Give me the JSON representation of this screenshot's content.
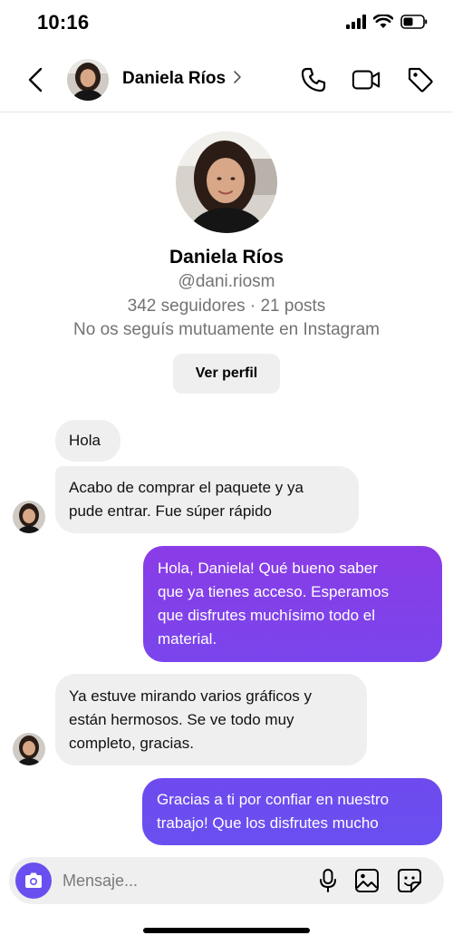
{
  "status_bar": {
    "time": "10:16",
    "icons": [
      "signal-icon",
      "wifi-icon",
      "battery-icon"
    ]
  },
  "header": {
    "contact_name": "Daniela Ríos",
    "icons": [
      "back-arrow-icon",
      "chevron-right-icon",
      "phone-icon",
      "video-camera-icon",
      "tag-icon"
    ]
  },
  "profile": {
    "name": "Daniela Ríos",
    "handle": "@dani.riosm",
    "stats": "342 seguidores · 21 posts",
    "mutual": "No os seguís mutuamente en Instagram",
    "view_profile_label": "Ver perfil"
  },
  "messages": [
    {
      "direction": "incoming",
      "lines": [
        "Hola"
      ]
    },
    {
      "direction": "incoming",
      "lines": [
        "Acabo de comprar el paquete y ya",
        "pude entrar. Fue súper rápido"
      ]
    },
    {
      "direction": "outgoing",
      "lines": [
        "Hola, Daniela! Qué bueno saber",
        "que ya tienes acceso. Esperamos",
        "que disfrutes muchísimo todo el",
        "material."
      ]
    },
    {
      "direction": "incoming",
      "lines": [
        "Ya estuve mirando varios gráficos y",
        "están hermosos. Se ve todo muy",
        "completo, gracias."
      ]
    },
    {
      "direction": "outgoing",
      "lines": [
        "Gracias a ti por confiar en nuestro",
        "trabajo! Que los disfrutes mucho"
      ]
    }
  ],
  "composer": {
    "placeholder": "Mensaje...",
    "value": "",
    "icons": [
      "camera-icon",
      "microphone-icon",
      "gallery-icon",
      "sticker-icon"
    ]
  },
  "colors": {
    "incoming_bubble": "#efefef",
    "outgoing_gradient_start": "#8a3ce6",
    "outgoing_gradient_end": "#6a4ff0",
    "camera_button": "#6a4ff0",
    "secondary_text": "#737373"
  }
}
